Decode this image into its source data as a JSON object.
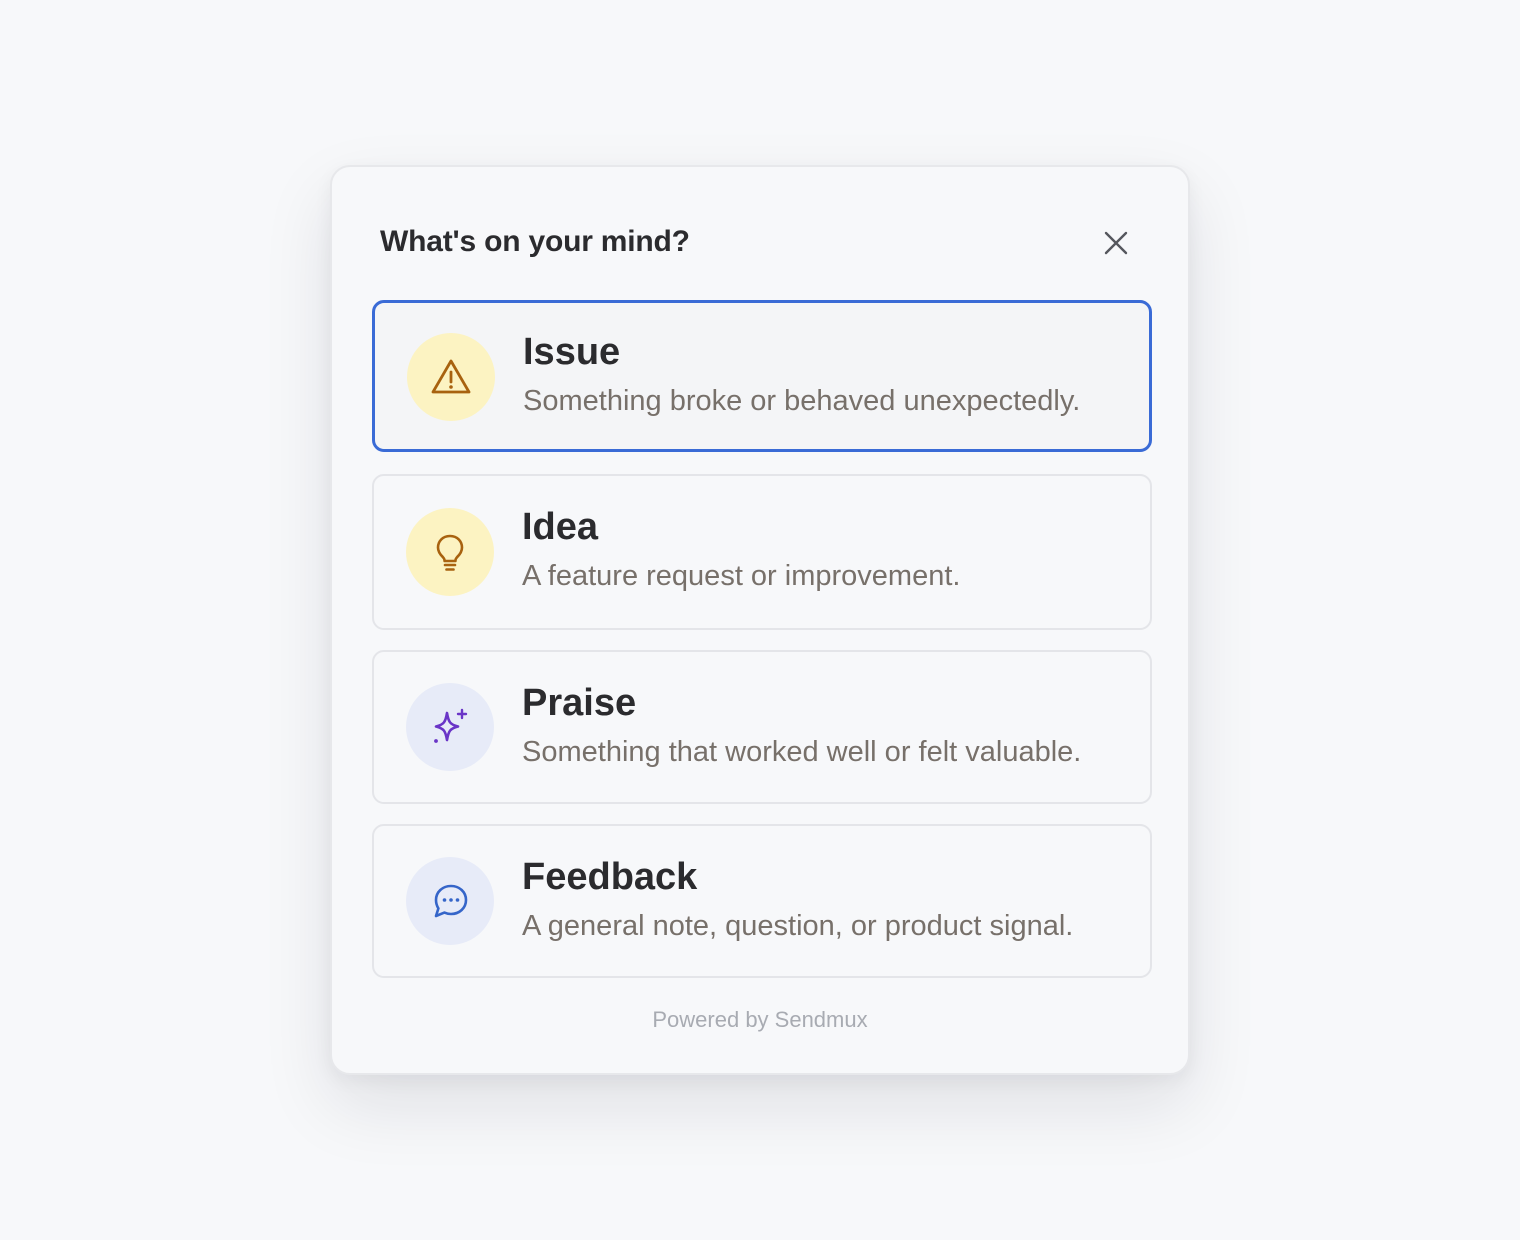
{
  "dialog": {
    "title": "What's on your mind?",
    "close_icon": "close-icon",
    "footer": "Powered by Sendmux"
  },
  "options": [
    {
      "title": "Issue",
      "description": "Something broke or behaved unexpectedly.",
      "icon": "warning-icon",
      "icon_bg": "#fcf3c2",
      "icon_color": "#a8620f",
      "selected": true
    },
    {
      "title": "Idea",
      "description": "A feature request or improvement.",
      "icon": "lightbulb-icon",
      "icon_bg": "#fcf3c2",
      "icon_color": "#a8620f",
      "selected": false
    },
    {
      "title": "Praise",
      "description": "Something that worked well or felt valuable.",
      "icon": "sparkle-icon",
      "icon_bg": "#e7ebf8",
      "icon_color": "#6a35c7",
      "selected": false
    },
    {
      "title": "Feedback",
      "description": "A general note, question, or product signal.",
      "icon": "chat-bubble-icon",
      "icon_bg": "#e7ebf8",
      "icon_color": "#3565c9",
      "selected": false
    }
  ],
  "colors": {
    "accent": "#3a6bd6",
    "page_background": "#f7f8fa"
  }
}
